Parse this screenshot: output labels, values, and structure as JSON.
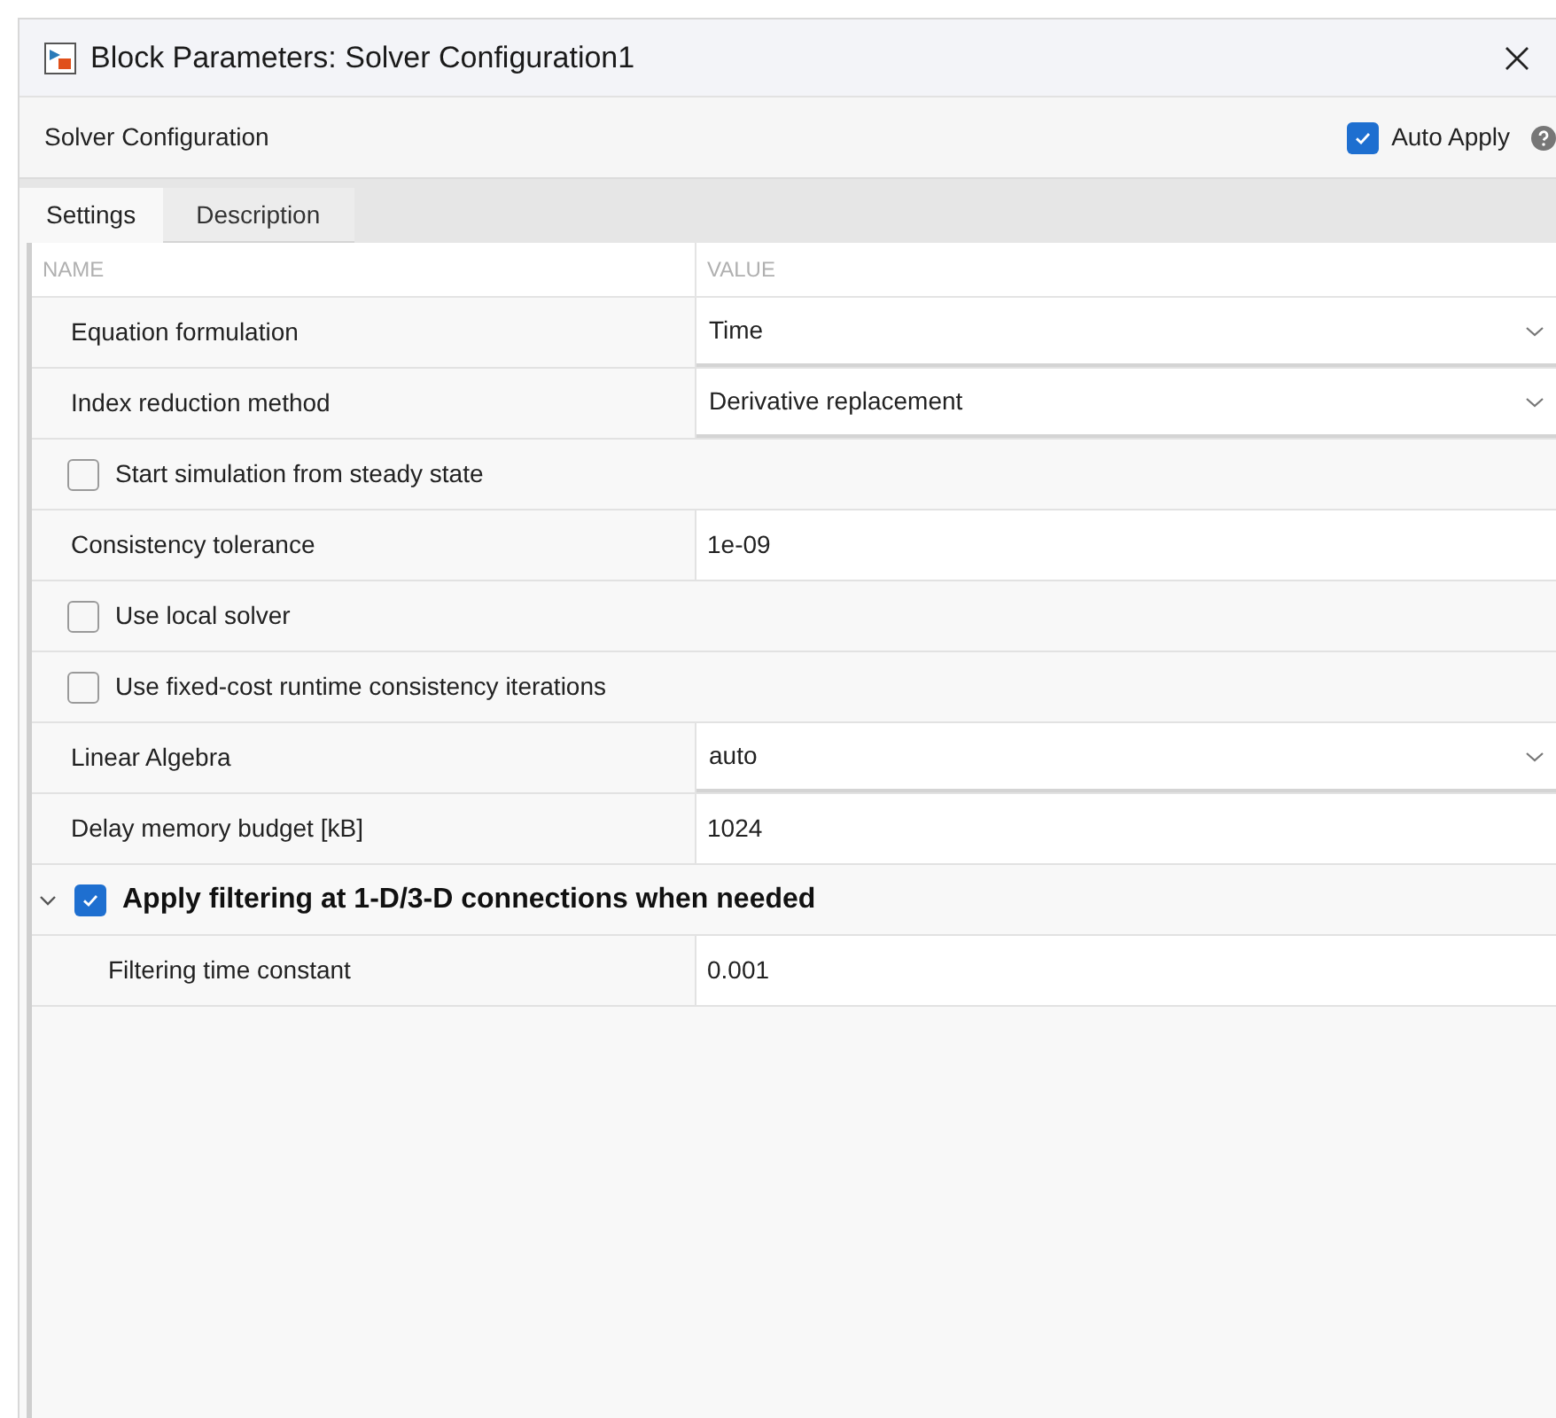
{
  "window": {
    "title": "Block Parameters: Solver Configuration1"
  },
  "header": {
    "block_name": "Solver Configuration",
    "auto_apply": {
      "label": "Auto Apply",
      "checked": true
    }
  },
  "tabs": [
    {
      "label": "Settings",
      "selected": true
    },
    {
      "label": "Description",
      "selected": false
    }
  ],
  "table": {
    "columns": [
      "NAME",
      "VALUE"
    ],
    "rows": [
      {
        "kind": "dropdown",
        "name": "Equation formulation",
        "value": "Time"
      },
      {
        "kind": "dropdown",
        "name": "Index reduction method",
        "value": "Derivative replacement"
      },
      {
        "kind": "checkbox",
        "name": "Start simulation from steady state",
        "checked": false
      },
      {
        "kind": "edit",
        "name": "Consistency tolerance",
        "value": "1e-09"
      },
      {
        "kind": "checkbox",
        "name": "Use local solver",
        "checked": false
      },
      {
        "kind": "checkbox",
        "name": "Use fixed-cost runtime consistency iterations",
        "checked": false
      },
      {
        "kind": "dropdown",
        "name": "Linear Algebra",
        "value": "auto"
      },
      {
        "kind": "edit",
        "name": "Delay memory budget [kB]",
        "value": "1024"
      },
      {
        "kind": "group",
        "name": "Apply filtering at 1-D/3-D connections when needed",
        "checked": true,
        "expanded": true,
        "children": [
          {
            "kind": "edit",
            "name": "Filtering time constant",
            "value": "0.001"
          }
        ]
      }
    ]
  }
}
